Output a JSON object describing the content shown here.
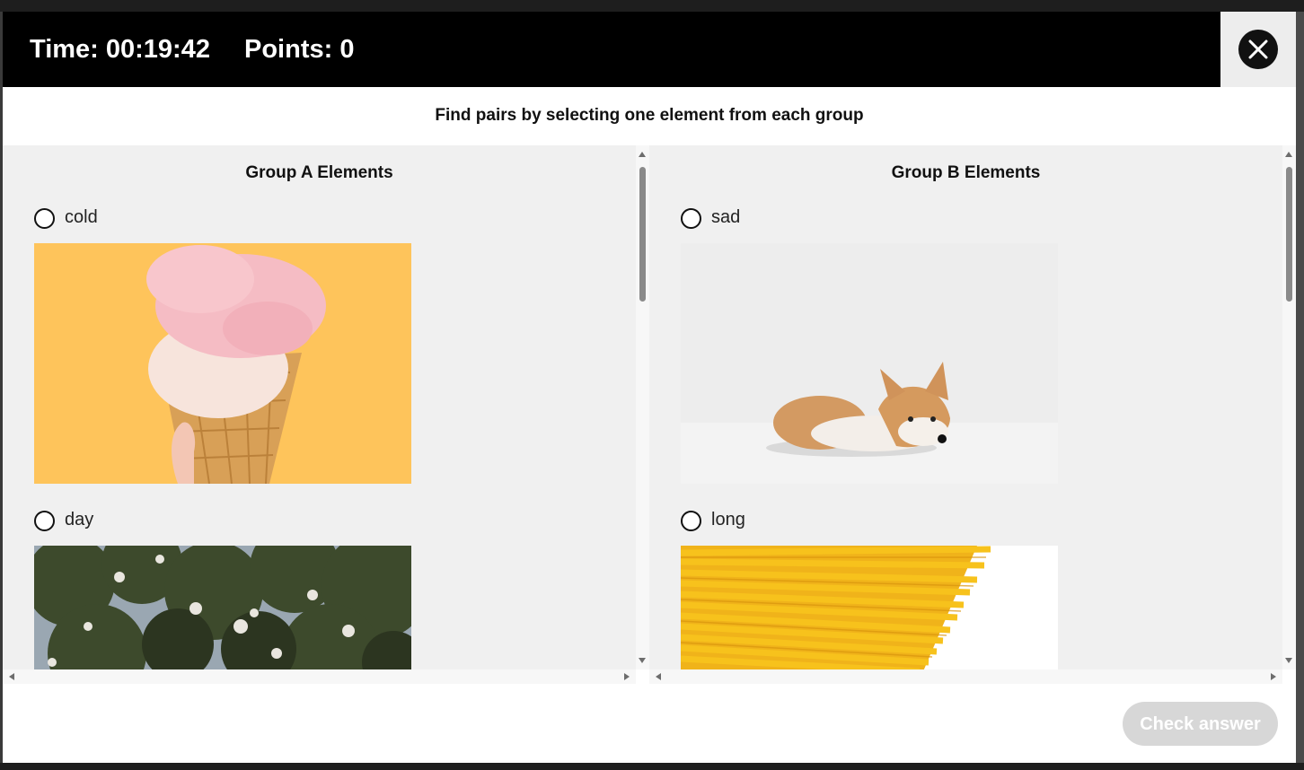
{
  "header": {
    "time_text": "Time: 00:19:42",
    "points_text": "Points: 0"
  },
  "instruction": "Find pairs by selecting one element from each group",
  "group_a": {
    "title": "Group A Elements",
    "items": [
      {
        "label": "cold",
        "image": "ice-cream-cone-photo"
      },
      {
        "label": "day",
        "image": "flowering-tree-photo"
      }
    ]
  },
  "group_b": {
    "title": "Group B Elements",
    "items": [
      {
        "label": "sad",
        "image": "corgi-dog-lying-photo"
      },
      {
        "label": "long",
        "image": "spaghetti-photo"
      }
    ]
  },
  "check_button_label": "Check answer",
  "colors": {
    "header_bg": "#000000",
    "panel_bg": "#f0f0f0",
    "button_disabled": "#d7d7d7"
  }
}
